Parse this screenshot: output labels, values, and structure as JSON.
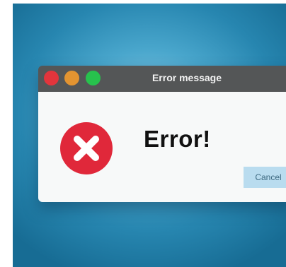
{
  "window": {
    "title": "Error message",
    "controls": {
      "close_color": "#e2353c",
      "minimize_color": "#e39431",
      "maximize_color": "#27c24d"
    }
  },
  "dialog": {
    "icon": "error-x-icon",
    "icon_color": "#e0283a",
    "heading": "Error!",
    "cancel_label": "Cancel"
  }
}
